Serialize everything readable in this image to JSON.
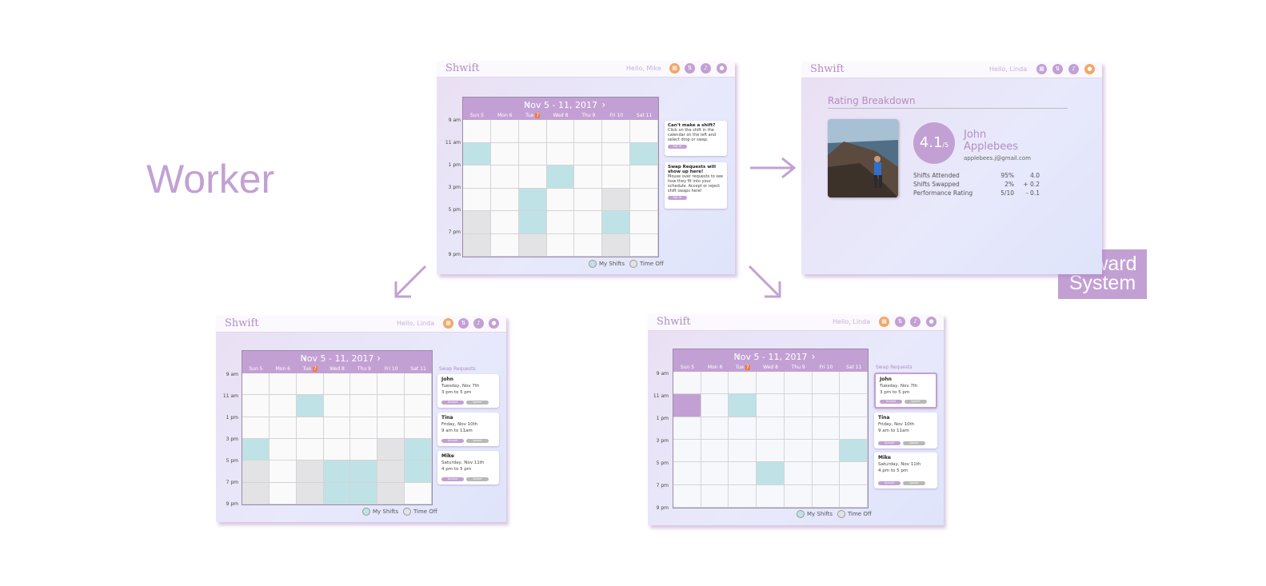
{
  "headline": "Worker",
  "reward_label": [
    "Reward",
    "System"
  ],
  "app": {
    "logo": "Shwift",
    "calendar": {
      "range": "Nov 5 - 11, 2017",
      "days": [
        "Sun 5",
        "Mon 6",
        "Tue",
        "Wed 8",
        "Thu 9",
        "Fri 10",
        "Sat 11"
      ],
      "today_badge": "7",
      "times": [
        "9 am",
        "11 am",
        "1 pm",
        "3 pm",
        "5 pm",
        "7 pm",
        "9 pm"
      ]
    },
    "legend": {
      "my_shifts": "My Shifts",
      "time_off": "Time Off"
    },
    "colors": {
      "accent": "#c3a0d4",
      "shift": "#bfe2e6",
      "time_off": "#e3e3e5",
      "today": "#f07a4a",
      "orange_icon": "#f2a766"
    },
    "icons": [
      "calendar-icon",
      "swap-icon",
      "bell-icon",
      "user-icon"
    ]
  },
  "screen_main": {
    "hello": "Hello, Mike",
    "tips": [
      {
        "title": "Can't make a shift?",
        "body": "Click on the shift in the calendar on the left and select drop or swap.",
        "button": "Got it!"
      },
      {
        "title": "Swap Requests will show up here!",
        "body": "Mouse over requests to see how they fit into your schedule. Accept or reject shift swaps here!",
        "button": "Got it!"
      }
    ]
  },
  "screen_rating": {
    "hello": "Hello, Linda",
    "title": "Rating Breakdown",
    "score": "4.1",
    "score_suffix": "/5",
    "first_name": "John",
    "last_name": "Applebees",
    "email": "applebees.j@gmail.com",
    "stats": [
      {
        "label": "Shifts Attended",
        "pct": "95%",
        "delta": "4.0"
      },
      {
        "label": "Shifts Swapped",
        "pct": "2%",
        "delta": "+ 0.2"
      },
      {
        "label": "Performance Rating",
        "pct": "5/10",
        "delta": "- 0.1"
      }
    ]
  },
  "screen_swaps": {
    "hello": "Hello, Linda",
    "title": "Swap Requests",
    "accept": "Accept",
    "ignore": "Ignore",
    "requests": [
      {
        "name": "John",
        "date": "Tuesday, Nov 7th",
        "time": "3 pm to 5 pm"
      },
      {
        "name": "Tina",
        "date": "Friday, Nov 10th",
        "time": "9 am to 11am"
      },
      {
        "name": "Mike",
        "date": "Saturday, Nov 11th",
        "time": "4 pm to 5 pm"
      }
    ]
  },
  "screen_preview": {
    "hello": "Hello, Linda"
  }
}
